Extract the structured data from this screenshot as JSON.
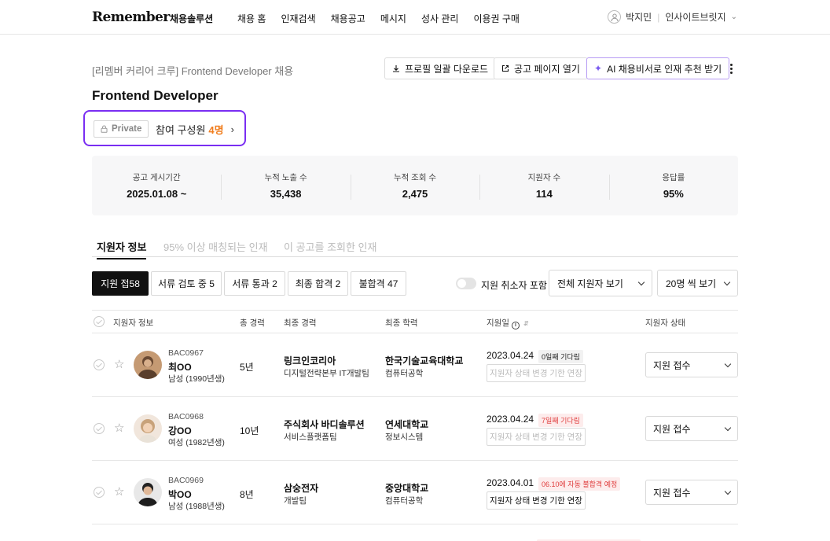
{
  "nav": {
    "logo": "Remember",
    "logo_sub": "채용솔루션",
    "items": [
      "채용 홈",
      "인재검색",
      "채용공고",
      "메시지",
      "성사 관리",
      "이용권 구매"
    ],
    "user_name": "박지민",
    "company": "인사이트브릿지"
  },
  "header": {
    "breadcrumb": "[리멤버 커리어 크루] Frontend Developer 채용",
    "download_label": "프로필 일괄 다운로드",
    "open_page_label": "공고 페이지 열기",
    "ai_label": "AI 채용비서로 인재 추천 받기",
    "title": "Frontend Developer",
    "private_label": "Private",
    "members_label": "참여 구성원",
    "members_count": "4명"
  },
  "stats": [
    {
      "label": "공고 게시기간",
      "value": "2025.01.08 ~"
    },
    {
      "label": "누적 노출 수",
      "value": "35,438"
    },
    {
      "label": "누적 조회 수",
      "value": "2,475"
    },
    {
      "label": "지원자 수",
      "value": "114"
    },
    {
      "label": "응답률",
      "value": "95%"
    }
  ],
  "tabs": [
    "지원자 정보",
    "95% 이상 매칭되는 인재",
    "이 공고를 조회한 인재"
  ],
  "filters": {
    "buttons": [
      "지원 접58",
      "서류 검토 중 5",
      "서류 통과 2",
      "최종 합격 2",
      "불합격 47"
    ],
    "toggle_label": "지원 취소자 포함",
    "view_select": "전체 지원자 보기",
    "page_select": "20명 씩 보기"
  },
  "table": {
    "headers": {
      "info": "지원자 정보",
      "career": "총 경력",
      "last_career": "최종 경력",
      "education": "최종 학력",
      "applied": "지원일",
      "status": "지원자 상태"
    },
    "rows": [
      {
        "id": "BAC0967",
        "name": "최OO",
        "meta": "남성 (1990년생)",
        "years": "5년",
        "company": "링크인코리아",
        "dept": "디지털전략본부 IT개발팀",
        "school": "한국기술교육대학교",
        "major": "컴퓨터공학",
        "date": "2023.04.24",
        "badge": "0일째 기다림",
        "badge_type": "gray",
        "extend_label": "지원자 상태 변경 기한 연장",
        "extend_enabled": false,
        "status": "지원 접수"
      },
      {
        "id": "BAC0968",
        "name": "강OO",
        "meta": "여성 (1982년생)",
        "years": "10년",
        "company": "주식회사 바디솔루션",
        "dept": "서비스플랫폼팀",
        "school": "연세대학교",
        "major": "정보시스템",
        "date": "2023.04.24",
        "badge": "7일째 기다림",
        "badge_type": "red",
        "extend_label": "지원자 상태 변경 기한 연장",
        "extend_enabled": false,
        "status": "지원 접수"
      },
      {
        "id": "BAC0969",
        "name": "박OO",
        "meta": "남성 (1988년생)",
        "years": "8년",
        "company": "삼숭전자",
        "dept": "개발팀",
        "school": "중앙대학교",
        "major": "컴퓨터공학",
        "date": "2023.04.01",
        "badge": "06.10에 자동 불합격 예정",
        "badge_type": "red",
        "extend_label": "지원자 상태 변경 기한 연장",
        "extend_enabled": true,
        "status": "지원 접수"
      }
    ]
  },
  "colors": {
    "accent_purple": "#7a2ef2",
    "count_orange": "#f07d1d",
    "alert_red": "#e03e3e"
  }
}
